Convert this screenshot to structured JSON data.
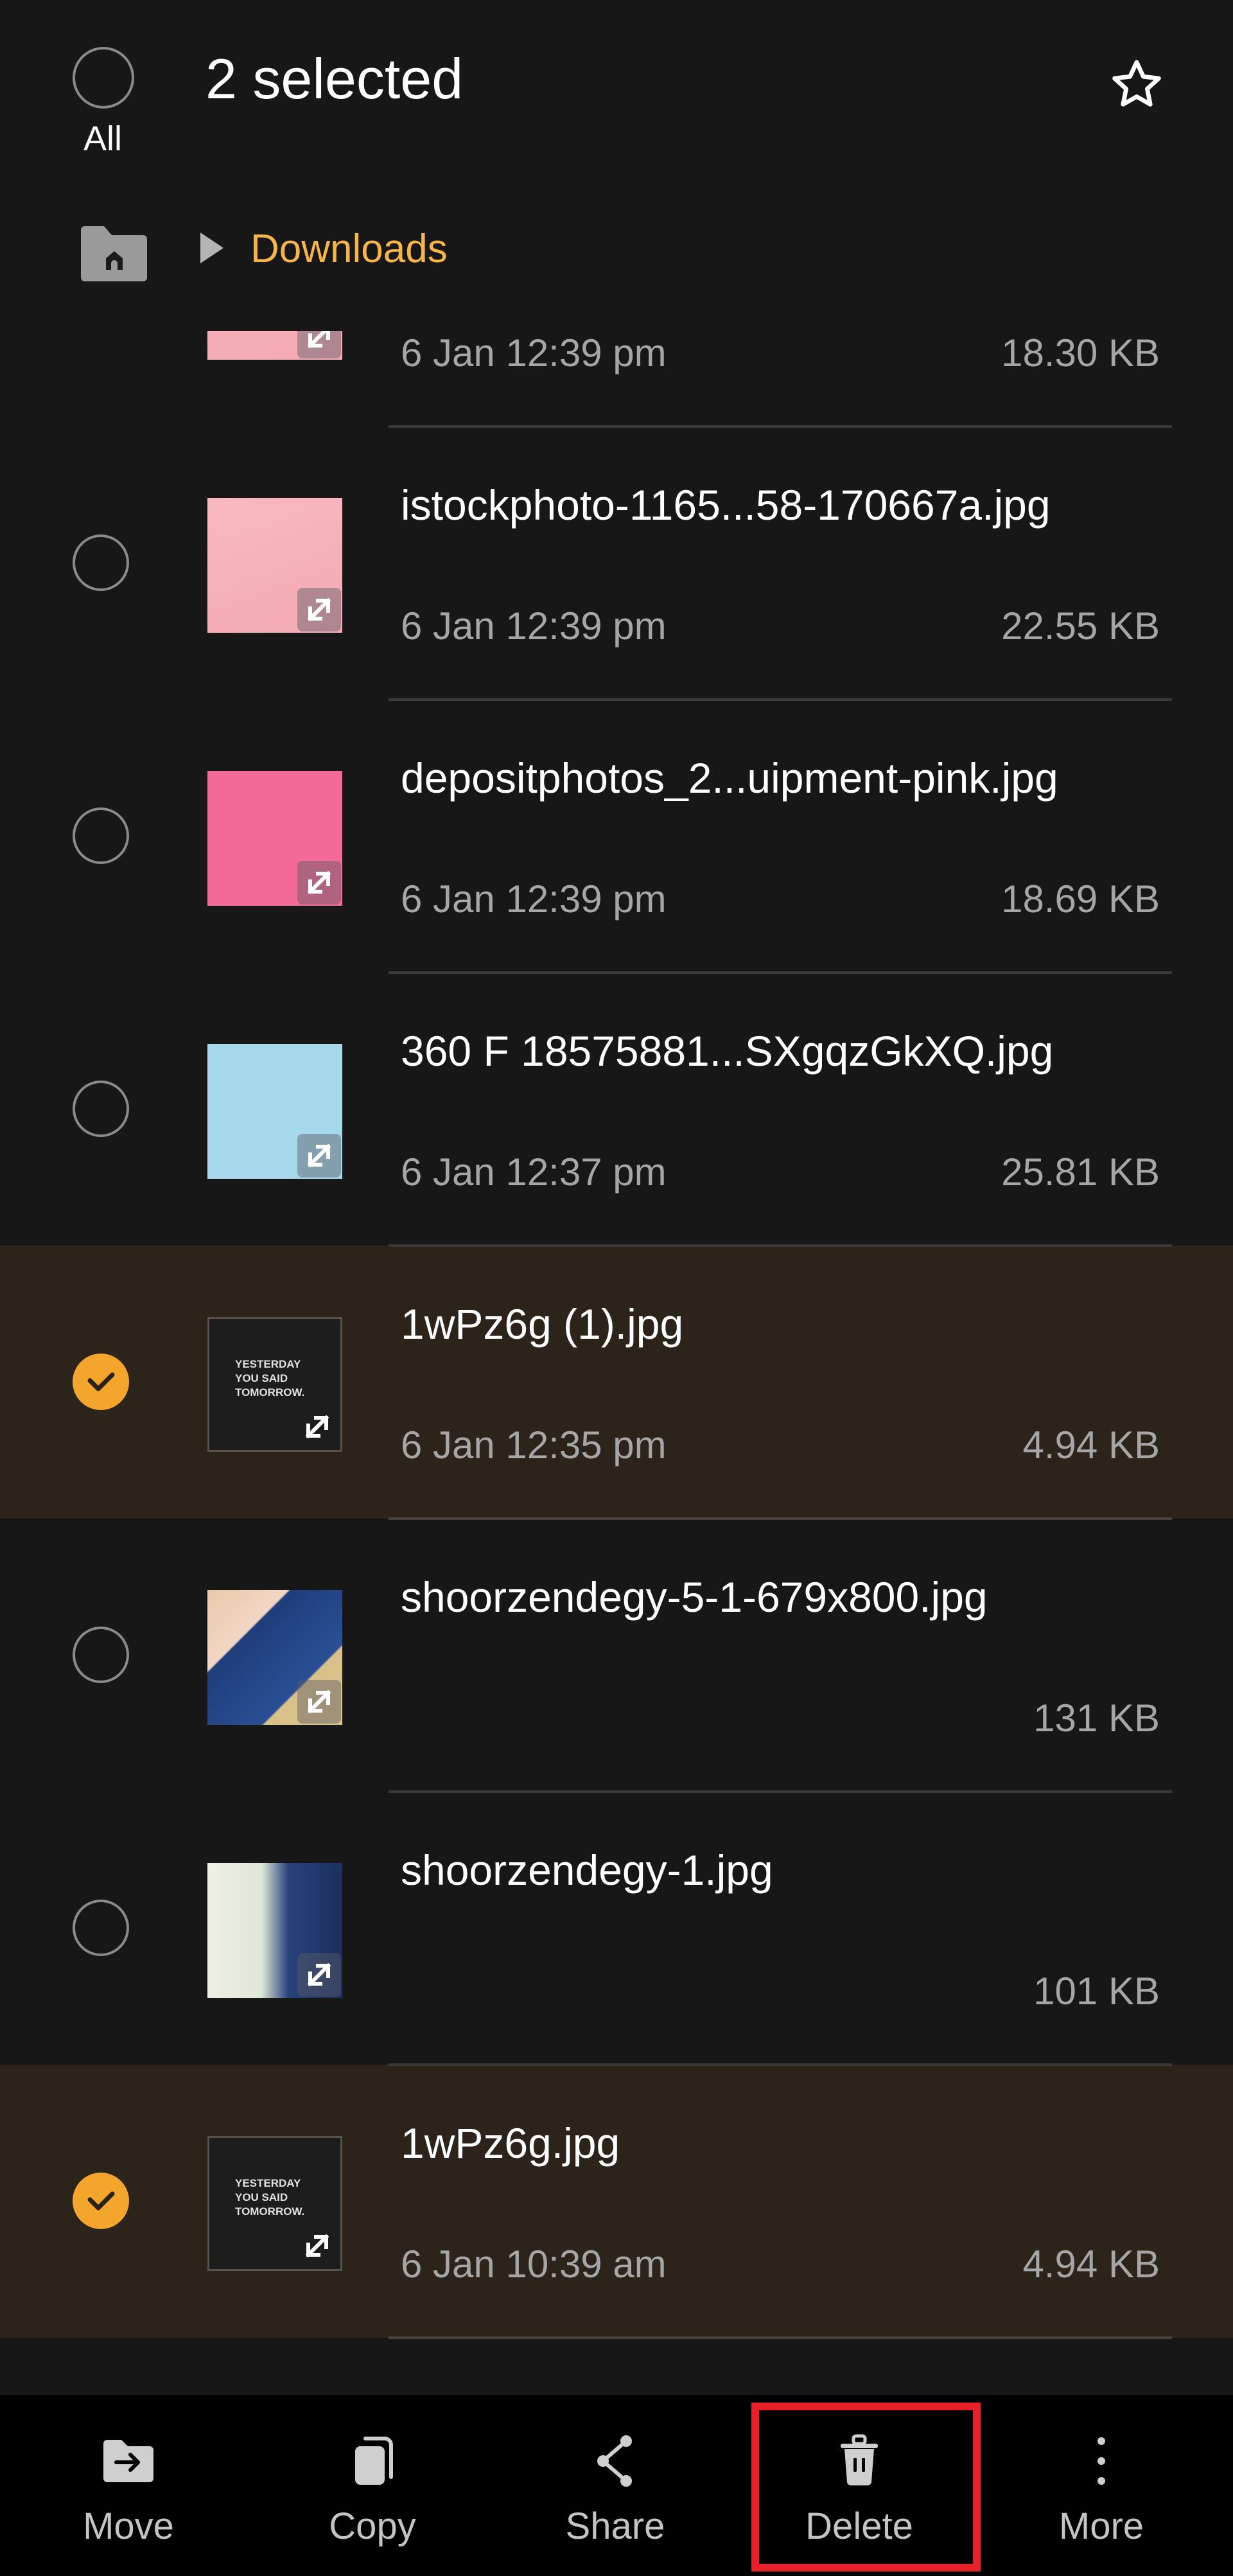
{
  "header": {
    "select_all_label": "All",
    "title": "2 selected",
    "favorite_icon": "star-outline-icon"
  },
  "breadcrumb": {
    "home_icon": "home-folder-icon",
    "separator_icon": "triangle-right-icon",
    "current": "Downloads"
  },
  "files": [
    {
      "name": "",
      "date": "6 Jan 12:39 pm",
      "size": "18.30 KB",
      "selected": false,
      "thumb": "t-pink1",
      "clipped": true
    },
    {
      "name": "istockphoto-1165...58-170667a.jpg",
      "date": "6 Jan 12:39 pm",
      "size": "22.55 KB",
      "selected": false,
      "thumb": "t-pink1"
    },
    {
      "name": "depositphotos_2...uipment-pink.jpg",
      "date": "6 Jan 12:39 pm",
      "size": "18.69 KB",
      "selected": false,
      "thumb": "t-pink2"
    },
    {
      "name": "360 F 18575881...SXgqzGkXQ.jpg",
      "date": "6 Jan 12:37 pm",
      "size": "25.81 KB",
      "selected": false,
      "thumb": "t-blue"
    },
    {
      "name": "1wPz6g (1).jpg",
      "date": "6 Jan 12:35 pm",
      "size": "4.94 KB",
      "selected": true,
      "thumb": "t-dark",
      "thumb_text": "YESTERDAY YOU SAID TOMORROW."
    },
    {
      "name": "shoorzendegy-5-1-679x800.jpg",
      "date": "",
      "size": "131 KB",
      "selected": false,
      "thumb": "t-book1"
    },
    {
      "name": "shoorzendegy-1.jpg",
      "date": "",
      "size": "101 KB",
      "selected": false,
      "thumb": "t-book2"
    },
    {
      "name": "1wPz6g.jpg",
      "date": "6 Jan 10:39 am",
      "size": "4.94 KB",
      "selected": true,
      "thumb": "t-dark",
      "thumb_text": "YESTERDAY YOU SAID TOMORROW."
    }
  ],
  "bottom_bar": {
    "items": [
      {
        "label": "Move",
        "icon": "move-to-folder-icon"
      },
      {
        "label": "Copy",
        "icon": "copy-icon"
      },
      {
        "label": "Share",
        "icon": "share-icon"
      },
      {
        "label": "Delete",
        "icon": "trash-icon",
        "highlighted": true
      },
      {
        "label": "More",
        "icon": "more-vertical-icon"
      }
    ]
  },
  "colors": {
    "background": "#171717",
    "accent": "#f3a52c",
    "breadcrumb_text": "#f6b548",
    "selected_row": "#2c241b",
    "highlight_box": "#e8202a"
  }
}
